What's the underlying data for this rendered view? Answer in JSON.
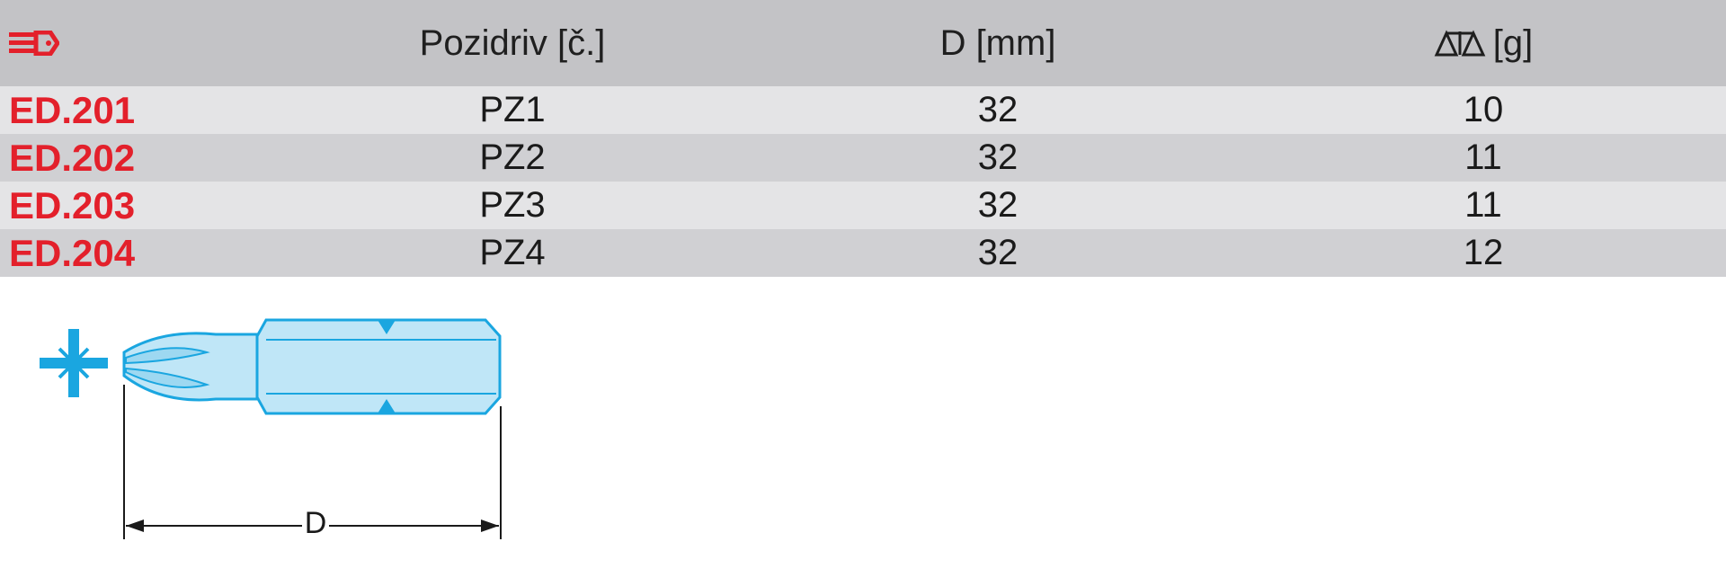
{
  "table": {
    "headers": {
      "ref_icon": "wrench-icon",
      "col1": "Pozidriv [č.]",
      "col2": "D [mm]",
      "col3_icon": "scale-icon",
      "col3": "[g]"
    },
    "rows": [
      {
        "ref": "ED.201",
        "size": "PZ1",
        "d": "32",
        "weight": "10"
      },
      {
        "ref": "ED.202",
        "size": "PZ2",
        "d": "32",
        "weight": "11"
      },
      {
        "ref": "ED.203",
        "size": "PZ3",
        "d": "32",
        "weight": "11"
      },
      {
        "ref": "ED.204",
        "size": "PZ4",
        "d": "32",
        "weight": "12"
      }
    ]
  },
  "drawing": {
    "dimension_label": "D",
    "profile_icon": "pozidriv-cross-icon",
    "bit_icon": "screwdriver-bit-icon"
  },
  "colors": {
    "brand_red": "#e3202b",
    "bit_blue": "#1aa6e0",
    "header_gray": "#c3c3c6"
  }
}
